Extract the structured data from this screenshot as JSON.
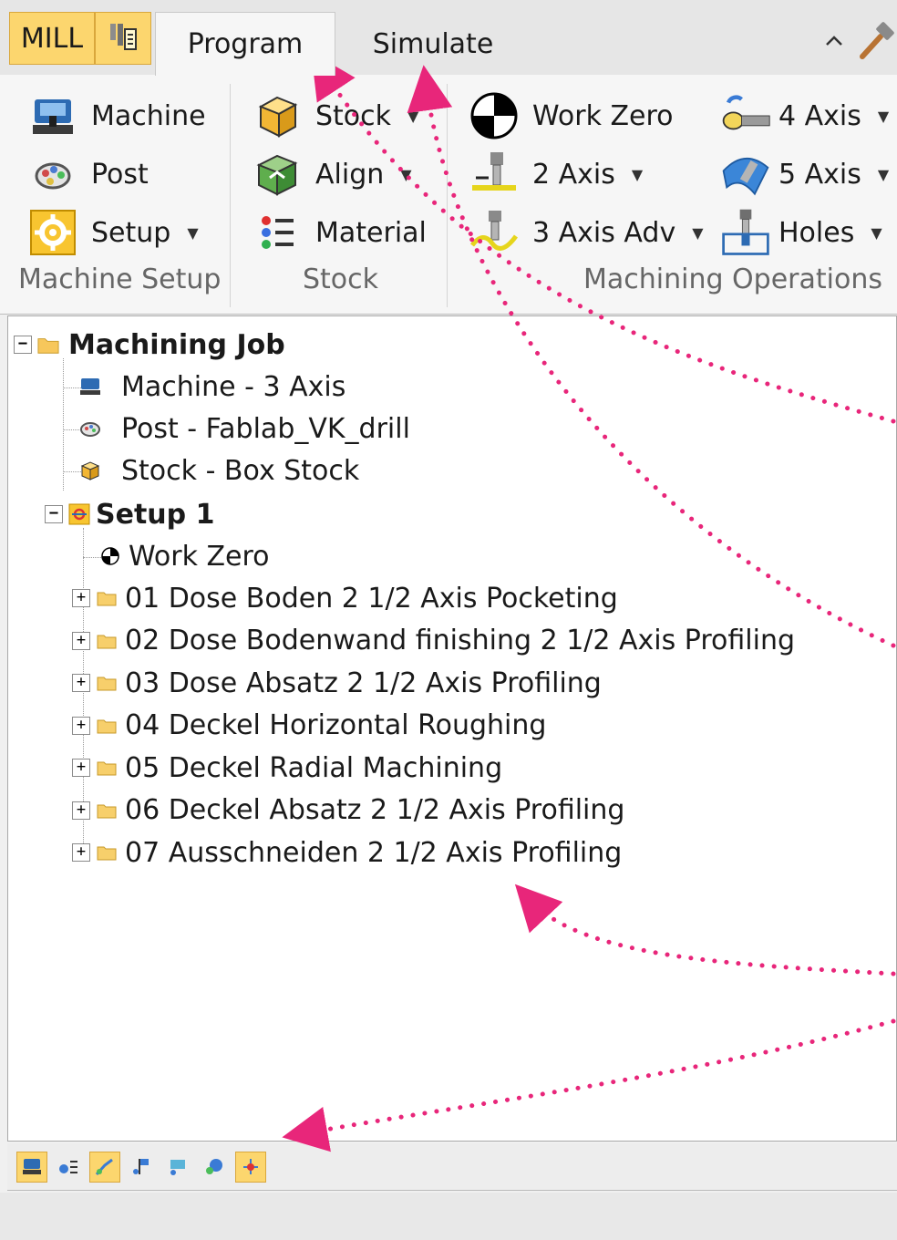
{
  "app_tabs": {
    "mill_label": "MILL",
    "program_label": "Program",
    "simulate_label": "Simulate"
  },
  "ribbon": {
    "machine_setup": {
      "machine": "Machine",
      "post": "Post",
      "setup": "Setup",
      "group_label": "Machine Setup"
    },
    "stock": {
      "stock": "Stock",
      "align": "Align",
      "material": "Material",
      "group_label": "Stock"
    },
    "machining_operations": {
      "work_zero": "Work Zero",
      "two_axis": "2 Axis",
      "three_axis_adv": "3 Axis Adv",
      "four_axis": "4 Axis",
      "five_axis": "5 Axis",
      "holes": "Holes",
      "group_label": "Machining Operations"
    }
  },
  "tree": {
    "root": "Machining Job",
    "machine": "Machine - 3 Axis",
    "post": "Post - Fablab_VK_drill",
    "stock": "Stock - Box Stock",
    "setup": "Setup 1",
    "work_zero": "Work Zero",
    "operations": [
      "01 Dose Boden 2 1/2 Axis Pocketing",
      "02 Dose Bodenwand finishing 2 1/2 Axis Profiling",
      "03 Dose Absatz 2 1/2 Axis Profiling",
      "04 Deckel Horizontal Roughing",
      "05 Deckel Radial Machining",
      "06 Deckel Absatz 2 1/2 Axis Profiling",
      "07 Ausschneiden 2 1/2 Axis Profiling"
    ]
  },
  "colors": {
    "accent": "#fcd66e",
    "annotation": "#e8267a"
  }
}
